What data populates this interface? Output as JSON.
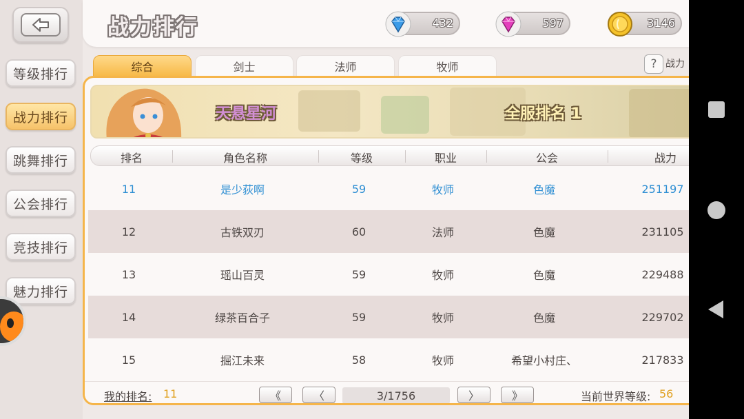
{
  "header": {
    "title": "战力排行",
    "currencies": [
      {
        "name": "blue-diamond",
        "value": "432",
        "color": "#2d8fe0"
      },
      {
        "name": "pink-diamond",
        "value": "597",
        "color": "#e23fb8"
      },
      {
        "name": "gold-coin",
        "value": "3146",
        "color": "#f2b41a"
      }
    ]
  },
  "sidebar": {
    "items": [
      {
        "label": "等级排行"
      },
      {
        "label": "战力排行",
        "active": true
      },
      {
        "label": "跳舞排行"
      },
      {
        "label": "公会排行"
      },
      {
        "label": "竞技排行"
      },
      {
        "label": "魅力排行"
      }
    ]
  },
  "tabs": [
    {
      "label": "综合",
      "active": true
    },
    {
      "label": "剑士"
    },
    {
      "label": "法师"
    },
    {
      "label": "牧师"
    }
  ],
  "help": {
    "icon": "?",
    "label": "战力"
  },
  "banner": {
    "character_name": "天悬星河",
    "server_rank": "全服排名 1"
  },
  "table": {
    "headers": [
      "排名",
      "角色名称",
      "等级",
      "职业",
      "公会",
      "战力"
    ],
    "rows": [
      {
        "rank": "11",
        "name": "是少荻啊",
        "level": "59",
        "class": "牧师",
        "guild": "色魔",
        "power": "251197",
        "is_me": true
      },
      {
        "rank": "12",
        "name": "古铁双刃",
        "level": "60",
        "class": "法师",
        "guild": "色魔",
        "power": "231105"
      },
      {
        "rank": "13",
        "name": "瑶山百灵",
        "level": "59",
        "class": "牧师",
        "guild": "色魔",
        "power": "229488"
      },
      {
        "rank": "14",
        "name": "绿茶百合子",
        "level": "59",
        "class": "牧师",
        "guild": "色魔",
        "power": "229702"
      },
      {
        "rank": "15",
        "name": "掘江未来",
        "level": "58",
        "class": "牧师",
        "guild": "希望小村庄、",
        "power": "217833"
      }
    ]
  },
  "footer": {
    "my_rank_label": "我的排名:",
    "my_rank_value": "11",
    "first_page": "《",
    "prev_page": "〈",
    "page_display": "3/1756",
    "next_page": "〉",
    "last_page": "》",
    "world_level_label": "当前世界等级:",
    "world_level_value": "56"
  }
}
